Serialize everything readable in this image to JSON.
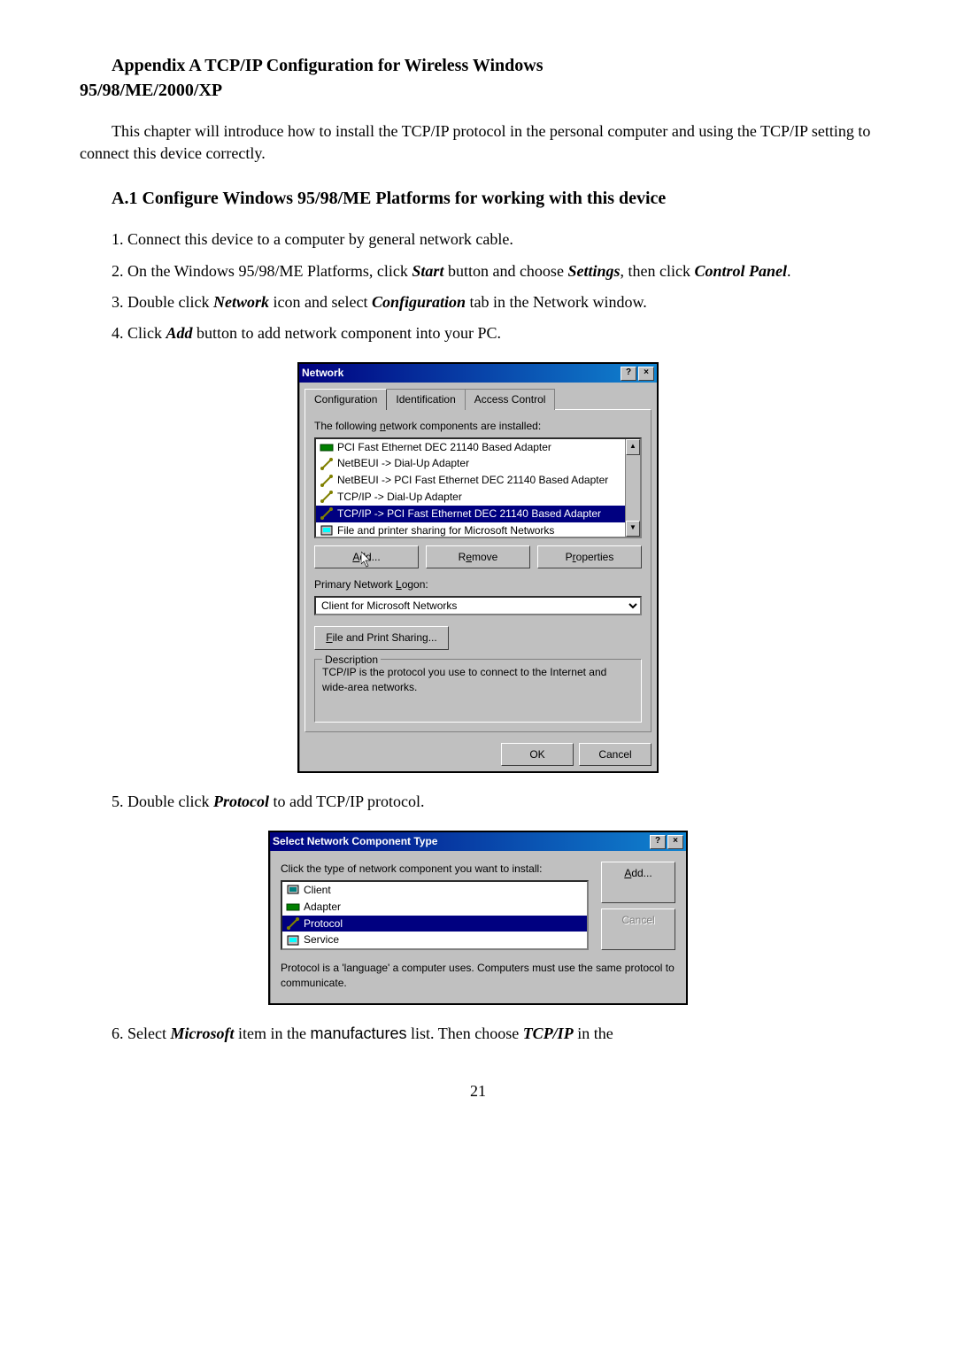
{
  "appendix": {
    "title_line1": "Appendix A    TCP/IP Configuration for Wireless Windows",
    "title_line2": "95/98/ME/2000/XP"
  },
  "intro": "This chapter will introduce how to install the TCP/IP protocol in the personal computer and using the TCP/IP setting to connect this device correctly.",
  "section": {
    "heading": "A.1 Configure Windows 95/98/ME Platforms for working with this device",
    "steps": [
      {
        "pre": "Connect this device to a computer by general network cable."
      },
      {
        "pre": "On the Windows 95/98/ME Platforms, click ",
        "b1": "Start",
        "mid1": " button and choose ",
        "b2": "Settings",
        "mid2": ", then click ",
        "b3": "Control Panel",
        "post": "."
      },
      {
        "pre": "Double click ",
        "b1": "Network",
        "mid1": " icon and select ",
        "b2": "Configuration",
        "mid2": " tab in the Network window."
      },
      {
        "pre": "Click ",
        "b1": "Add",
        "mid1": " button to add network component into your PC."
      }
    ],
    "step5": {
      "pre": "Double click ",
      "b1": "Protocol",
      "post": " to add TCP/IP protocol."
    },
    "step6": {
      "pre": "Select ",
      "b1": "Microsoft",
      "mid1": " item in the ",
      "plain": "manufactures",
      "mid2": " list. Then choose ",
      "b2": "TCP/IP",
      "post": " in the"
    }
  },
  "network_dialog": {
    "title": "Network",
    "tabs": [
      "Configuration",
      "Identification",
      "Access Control"
    ],
    "components_label": "The following network components are installed:",
    "components": [
      "PCI Fast Ethernet DEC 21140 Based Adapter",
      "NetBEUI -> Dial-Up Adapter",
      "NetBEUI -> PCI Fast Ethernet DEC 21140 Based Adapter",
      "TCP/IP -> Dial-Up Adapter",
      "TCP/IP -> PCI Fast Ethernet DEC 21140 Based Adapter",
      "File and printer sharing for Microsoft Networks"
    ],
    "selected_index": 4,
    "buttons": {
      "add": "Add...",
      "remove": "Remove",
      "properties": "Properties"
    },
    "logon_label": "Primary Network Logon:",
    "logon_value": "Client for Microsoft Networks",
    "fps_button": "File and Print Sharing...",
    "desc_title": "Description",
    "desc_text": "TCP/IP is the protocol you use to connect to the Internet and wide-area networks.",
    "ok": "OK",
    "cancel": "Cancel"
  },
  "select_dialog": {
    "title": "Select Network Component Type",
    "prompt": "Click the type of network component you want to install:",
    "items": [
      "Client",
      "Adapter",
      "Protocol",
      "Service"
    ],
    "selected_index": 2,
    "add": "Add...",
    "cancel": "Cancel",
    "desc": "Protocol is a 'language' a computer uses. Computers must use the same protocol to communicate."
  },
  "page_number": "21"
}
